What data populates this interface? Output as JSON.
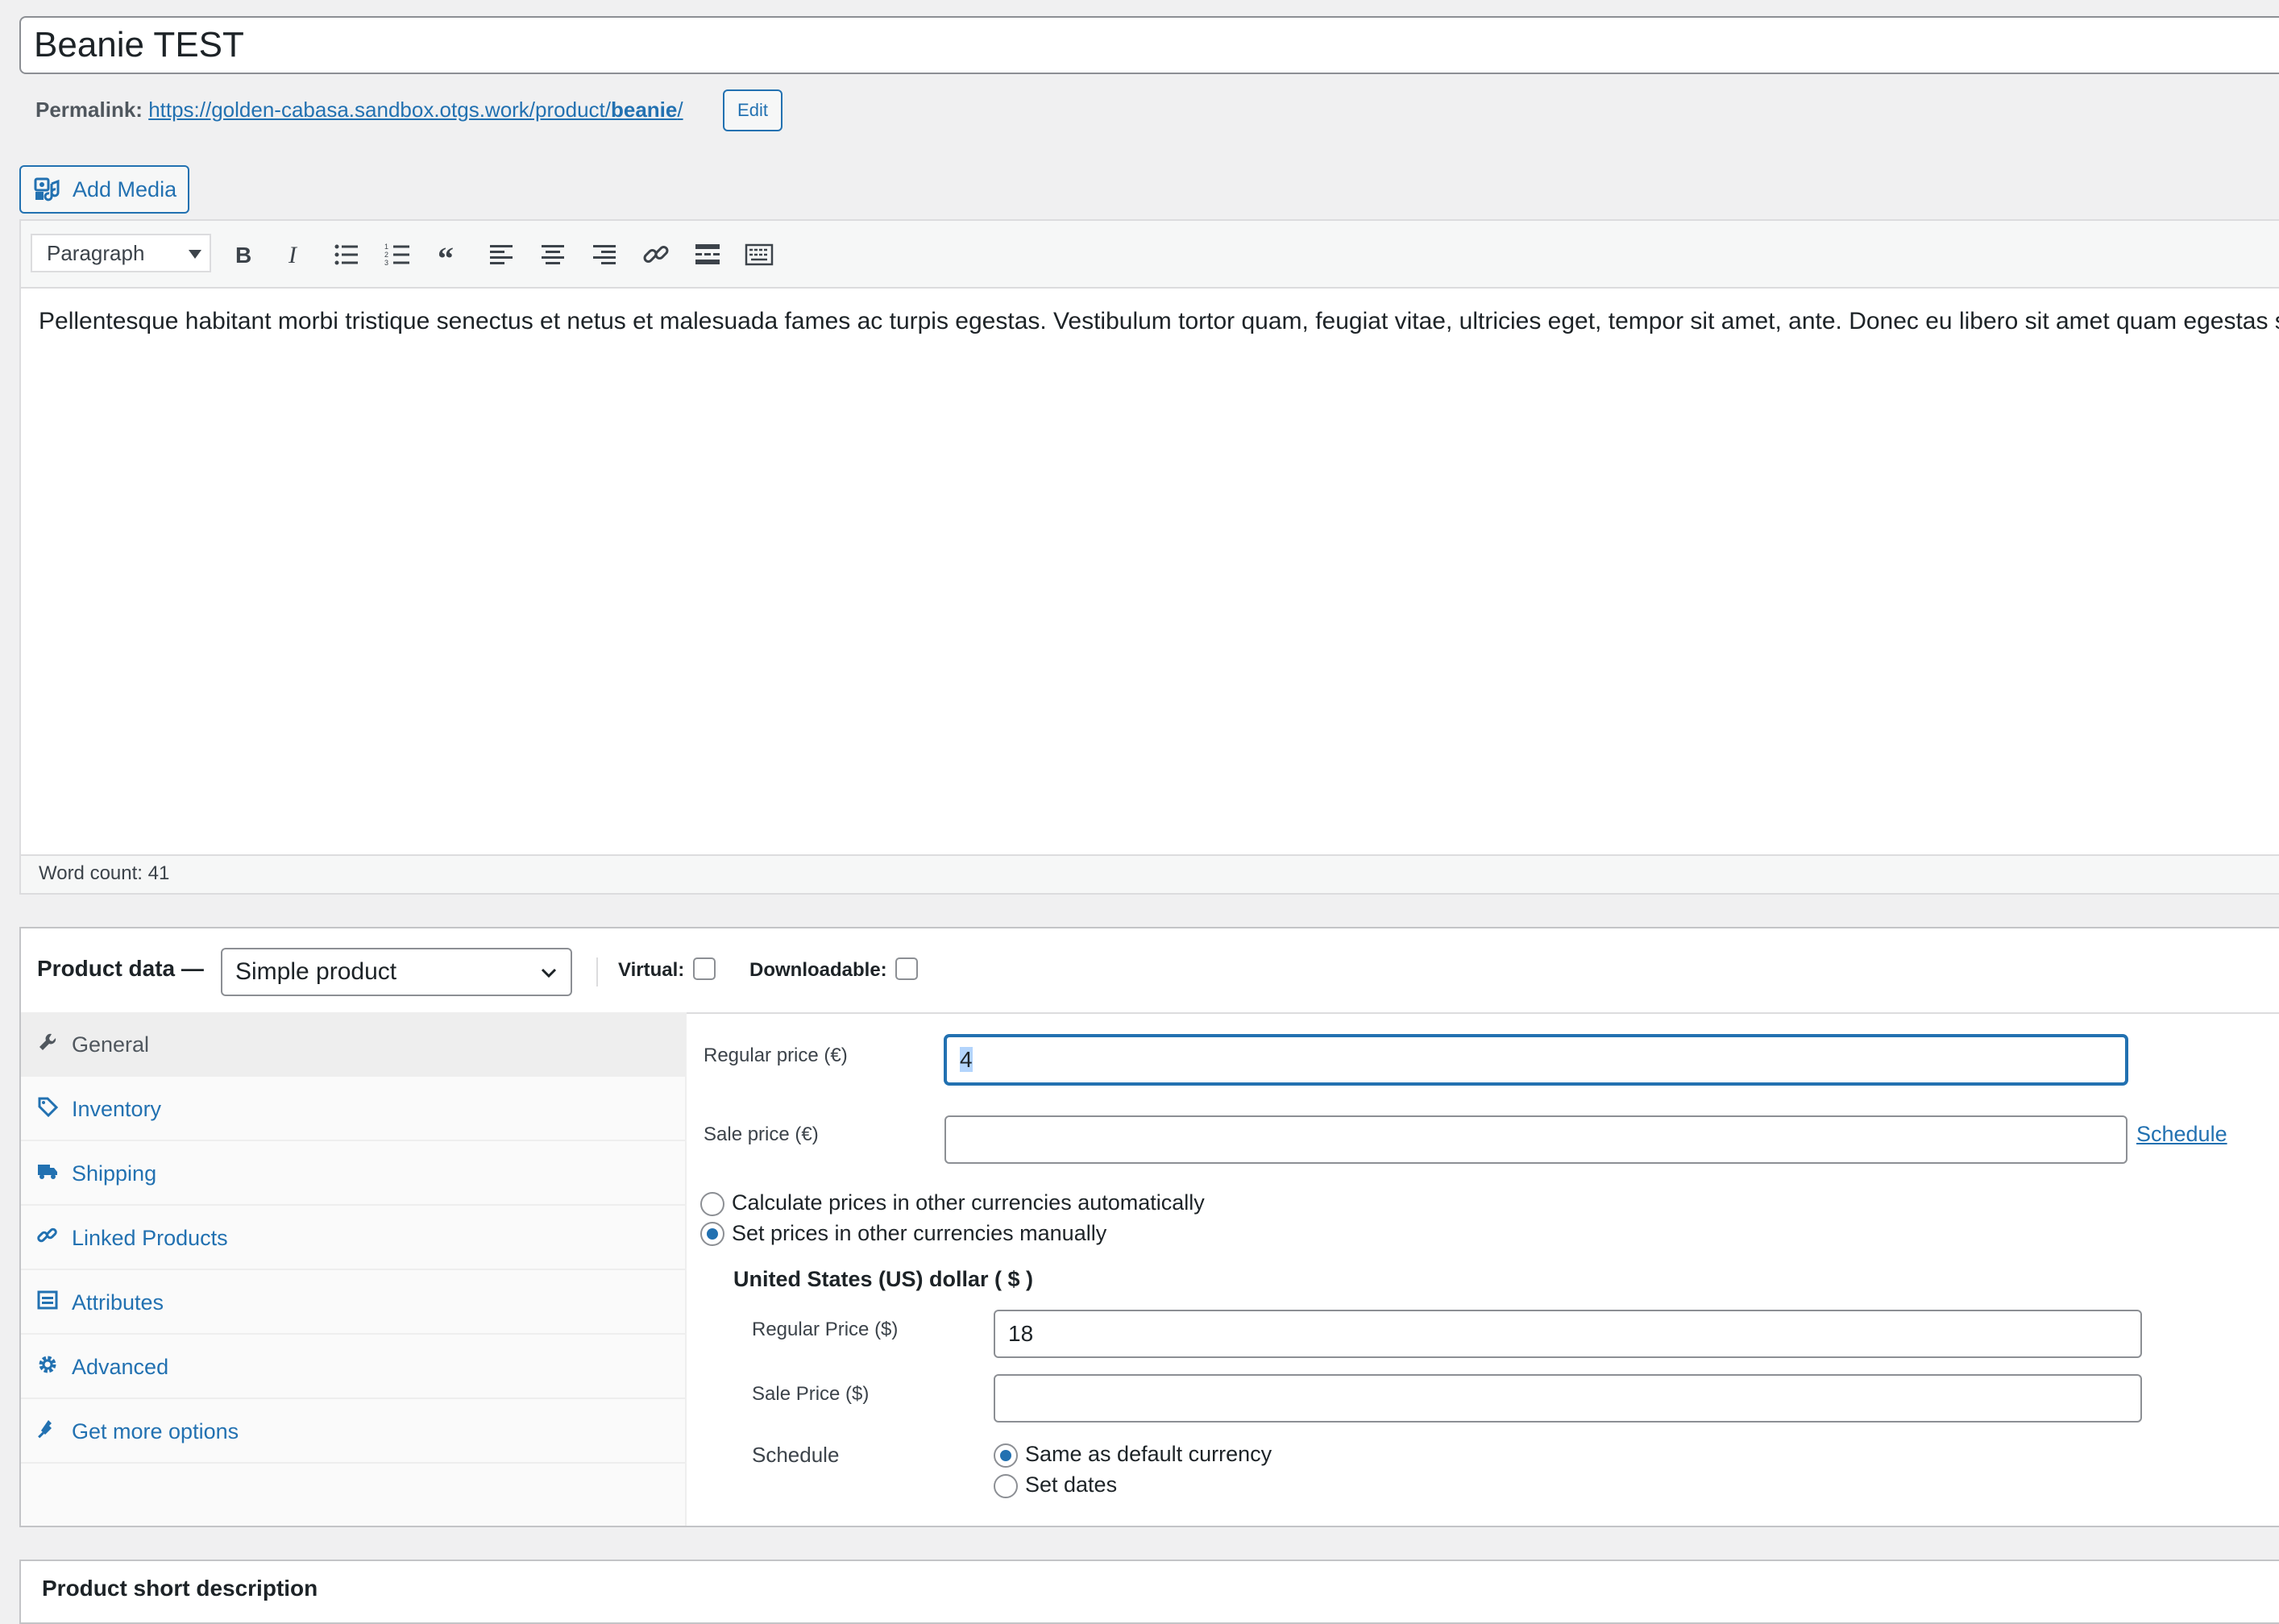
{
  "post": {
    "title": "Beanie TEST",
    "permalink_label": "Permalink:",
    "permalink_base": "https://golden-cabasa.sandbox.otgs.work/product/",
    "permalink_slug": "beanie",
    "permalink_trailing": "/",
    "edit_label": "Edit"
  },
  "media": {
    "add_media_label": "Add Media"
  },
  "editor": {
    "format_value": "Paragraph",
    "toolbar_icons": [
      "bold-icon",
      "italic-icon",
      "bulleted-list-icon",
      "numbered-list-icon",
      "blockquote-icon",
      "align-left-icon",
      "align-center-icon",
      "align-right-icon",
      "link-icon",
      "read-more-icon",
      "toolbar-toggle-icon"
    ],
    "content": "Pellentesque habitant morbi tristique senectus et netus et malesuada fames ac turpis egestas. Vestibulum tortor quam, feugiat vitae, ultricies eget, tempor sit amet, ante. Donec eu libero sit amet quam egestas s",
    "word_count": "Word count: 41"
  },
  "product_data": {
    "title": "Product data —",
    "type_value": "Simple product",
    "virtual_label": "Virtual:",
    "downloadable_label": "Downloadable:",
    "tabs": [
      {
        "label": "General",
        "icon": "wrench-icon"
      },
      {
        "label": "Inventory",
        "icon": "tag-icon"
      },
      {
        "label": "Shipping",
        "icon": "truck-icon"
      },
      {
        "label": "Linked Products",
        "icon": "link-icon"
      },
      {
        "label": "Attributes",
        "icon": "list-icon"
      },
      {
        "label": "Advanced",
        "icon": "gear-icon"
      },
      {
        "label": "Get more options",
        "icon": "plugin-icon"
      }
    ],
    "general": {
      "regular_price_label": "Regular price (€)",
      "regular_price_value": "4",
      "sale_price_label": "Sale price (€)",
      "sale_price_value": "",
      "schedule_link": "Schedule",
      "auto_currency_label": "Calculate prices in other currencies automatically",
      "manual_currency_label": "Set prices in other currencies manually",
      "currency_heading": "United States (US) dollar ( $ )",
      "usd_regular_label": "Regular Price ($)",
      "usd_regular_value": "18",
      "usd_sale_label": "Sale Price ($)",
      "usd_sale_value": "",
      "schedule_label": "Schedule",
      "same_as_default_label": "Same as default currency",
      "set_dates_label": "Set dates"
    }
  },
  "short_description": {
    "title": "Product short description"
  },
  "colors": {
    "accent": "#2271b1",
    "background": "#f0f0f1"
  }
}
